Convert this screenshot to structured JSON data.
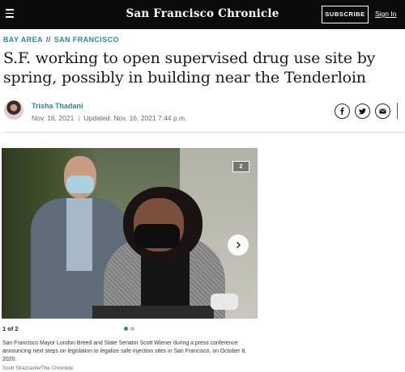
{
  "header": {
    "logo": "San Francisco Chronicle",
    "subscribe_label": "SUBSCRIBE",
    "signin_label": "Sign In",
    "menu_icon": "hamburger-icon"
  },
  "breadcrumb": {
    "section": "BAY AREA",
    "separator": "//",
    "subsection": "SAN FRANCISCO"
  },
  "article": {
    "headline": "S.F. working to open supervised drug use site by spring, possibly in building near the Tenderloin",
    "author": "Trisha Thadani",
    "published": "Nov. 16, 2021",
    "updated": "Updated: Nov. 16, 2021 7:44 p.m."
  },
  "share": {
    "icons": [
      "facebook-icon",
      "twitter-icon",
      "email-icon"
    ]
  },
  "gallery": {
    "image_count_badge": "2",
    "counter": "1 of 2",
    "active_index": 1,
    "total": 2,
    "caption": "San Francisco Mayor London Breed and State Senator Scott Wiener during a press conference announcing next steps on legislation to legalize safe injection sites in San Francisco, on October 8, 2020.",
    "credit": "Scott Strazzante/The Chronicle",
    "next_icon": "chevron-right-icon"
  },
  "colors": {
    "accent": "#2a8a8f",
    "header_bg": "#0b0b0b",
    "text": "#1a1a1a"
  }
}
